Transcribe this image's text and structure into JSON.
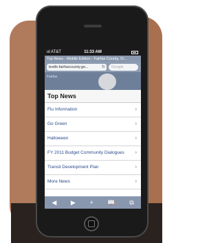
{
  "status_bar": {
    "carrier": "ul AT&T",
    "time": "11:33 AM"
  },
  "browser": {
    "page_title": "Top News - Mobile Edition - Fairfax County, Vi...",
    "url": "testfx.fairfaxcounty.go...",
    "search_placeholder": "Google"
  },
  "hero": {
    "label": "Fairfax"
  },
  "page": {
    "heading": "Top News",
    "items": [
      {
        "label": "Flu Information"
      },
      {
        "label": "Go Green"
      },
      {
        "label": "Halloween"
      },
      {
        "label": "FY 2011 Budget Community Dialogues"
      },
      {
        "label": "Transit Development Plan"
      },
      {
        "label": "More News"
      }
    ],
    "chevron": "›"
  },
  "toolbar": {
    "back": "◀",
    "forward": "▶",
    "add": "+",
    "bookmarks": "📖",
    "pages": "⧉"
  }
}
